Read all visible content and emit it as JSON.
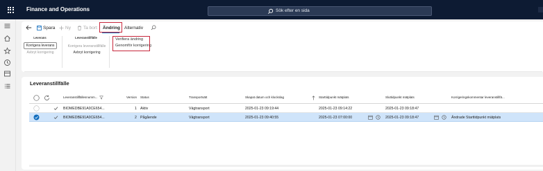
{
  "app": {
    "title": "Finance and Operations"
  },
  "search": {
    "placeholder": "Sök efter en sida"
  },
  "actionpane": {
    "save": "Spara",
    "new": "Ny",
    "delete": "Ta bort",
    "tab_andring": "Ändring",
    "tab_alternativ": "Alternativ"
  },
  "groups": {
    "leverans": {
      "title": "Leverans",
      "korrigera": "Korrigera leverans",
      "avbryt": "Avbryt korrigering"
    },
    "leveranstillfalle": {
      "title": "Leveranstillfälle",
      "korrigera": "Korrigera leveranstillfälle",
      "avbryt": "Avbryt korrigering"
    },
    "andring_menu": {
      "verifiera": "Verifiera ändring",
      "genomfor": "Genomför korrigering"
    }
  },
  "grid": {
    "title": "Leveranstillfälle",
    "columns": {
      "id": "Leveranstillfällesnumm...",
      "version": "Version",
      "status": "Status",
      "transportsatt": "Transportsätt",
      "skapat": "Skapat datum och klockslag",
      "start": "Starttidpunkt mätplats",
      "slut": "Sluttidpunkt mätplats",
      "kommentar": "Korrigeringskommentar leveranstillfä..."
    },
    "rows": [
      {
        "id": "BIOMEDBE91A0CE654...",
        "version": "1",
        "status": "Aktiv",
        "transportsatt": "Vägtransport",
        "skapat": "2025-01-23 09:19:44",
        "start": "2025-01-23 09:14:22",
        "slut": "2025-01-23 09:18:47",
        "kommentar": ""
      },
      {
        "id": "BIOMEDBE91A0CE654...",
        "version": "2",
        "status": "Pågående",
        "transportsatt": "Vägtransport",
        "skapat": "2025-01-23 09:40:55",
        "start": "2025-01-23 07:00:00",
        "slut": "2025-01-23 09:18:47",
        "kommentar": "Ändrade Starttidpunkt mätplats"
      }
    ]
  },
  "colors": {
    "topbar": "#0d1b33",
    "accent": "#0f6cbd",
    "highlight_box": "#c7263b",
    "selected_row": "#cfe4fa"
  }
}
